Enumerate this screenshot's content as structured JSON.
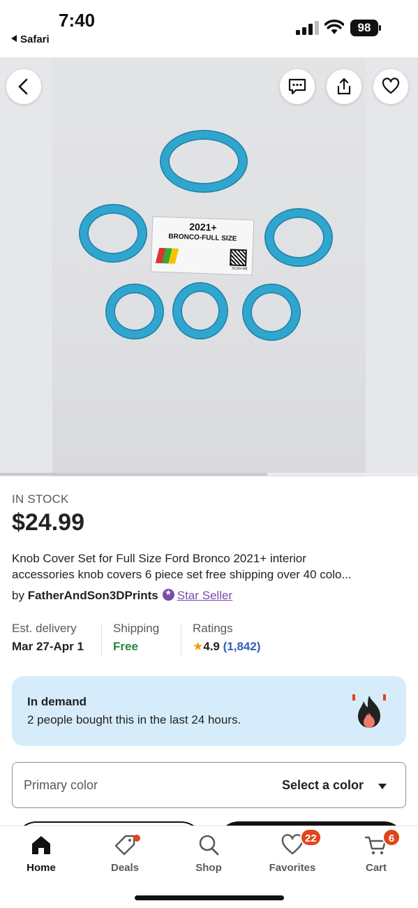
{
  "status_bar": {
    "time": "7:40",
    "back_app": "Safari",
    "battery": "98"
  },
  "gallery": {
    "image_label_year": "2021+",
    "image_label_name": "BRONCO-FULL SIZE",
    "image_label_scan": "SCAN ME",
    "image_progress": 0.64,
    "actions": [
      "back-icon",
      "message-icon",
      "share-icon",
      "heart-icon"
    ]
  },
  "product": {
    "stock": "IN STOCK",
    "price": "$24.99",
    "title_line1": "Knob Cover Set for Full Size Ford Bronco 2021+ interior",
    "title_line2": "accessories knob covers 6 piece set free shipping over 40 colo...",
    "seller_prefix": "by",
    "seller_name": "FatherAndSon3DPrints",
    "seller_badge": "Star Seller"
  },
  "meta": {
    "delivery_label": "Est. delivery",
    "delivery_value": "Mar 27-Apr 1",
    "shipping_label": "Shipping",
    "shipping_value": "Free",
    "ratings_label": "Ratings",
    "ratings_value": "4.9",
    "ratings_count": "(1,842)"
  },
  "demand": {
    "heading": "In demand",
    "text": "2 people bought this in the last 24 hours."
  },
  "variation": {
    "label": "Primary color",
    "value": "Select a color"
  },
  "tabs": [
    {
      "label": "Home",
      "icon": "home-icon"
    },
    {
      "label": "Deals",
      "icon": "tag-icon"
    },
    {
      "label": "Shop",
      "icon": "search-icon"
    },
    {
      "label": "Favorites",
      "icon": "heart-icon",
      "badge": "22"
    },
    {
      "label": "Cart",
      "icon": "cart-icon",
      "badge": "6"
    }
  ],
  "colors": {
    "accent_blue": "#2fa6cf",
    "star_seller": "#7b4cae",
    "free_green": "#258635",
    "rating_link": "#2f5fba",
    "badge_orange": "#e0451b",
    "demand_bg": "#d6ecfa"
  }
}
